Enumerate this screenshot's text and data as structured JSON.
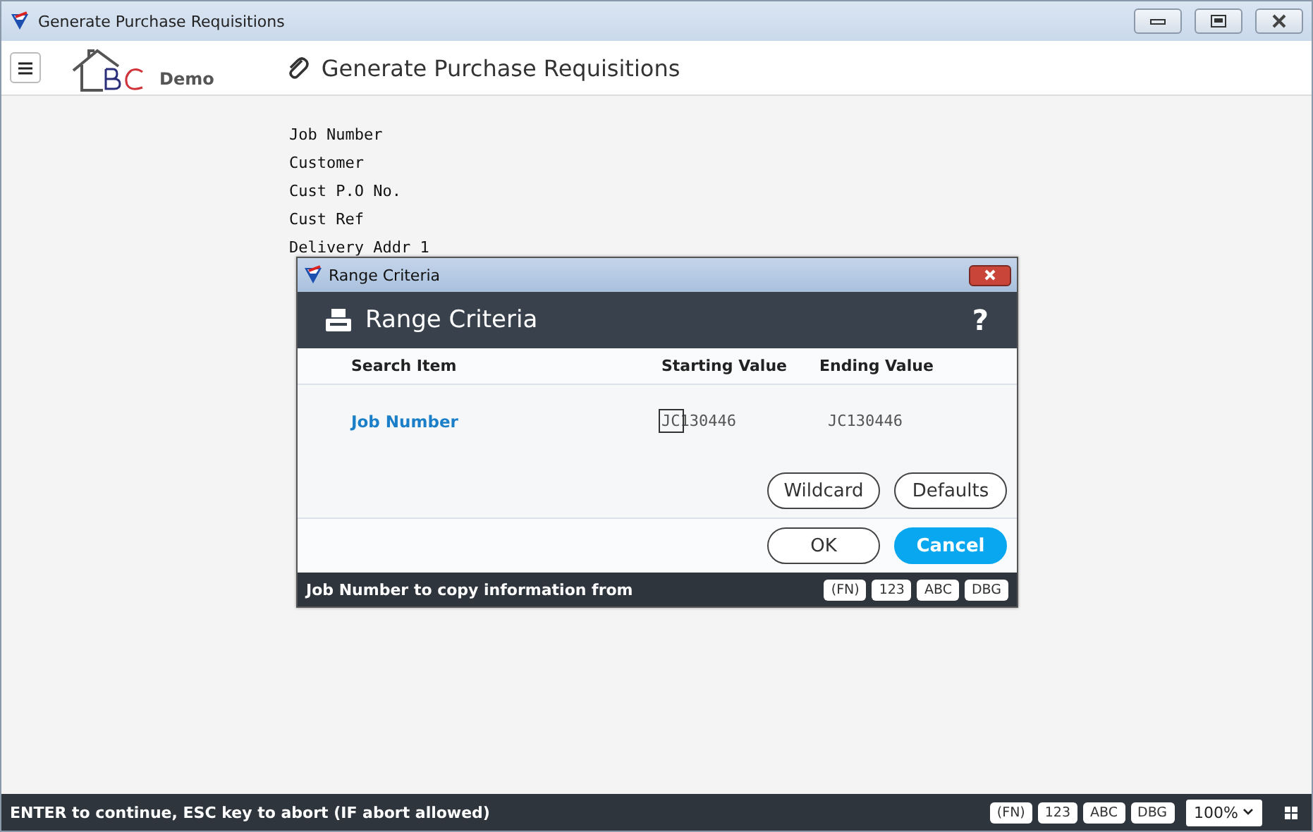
{
  "window": {
    "title": "Generate Purchase Requisitions"
  },
  "header": {
    "logo_text": "Demo",
    "title": "Generate Purchase Requisitions"
  },
  "form_labels": [
    "Job Number",
    "Customer",
    "Cust P.O No.",
    "Cust Ref",
    "Delivery Addr 1"
  ],
  "dialog": {
    "window_title": "Range Criteria",
    "heading": "Range Criteria",
    "help": "?",
    "columns": [
      "Search Item",
      "Starting Value",
      "Ending Value"
    ],
    "rows": [
      {
        "item": "Job Number",
        "start": "JC130446",
        "end": "JC130446"
      }
    ],
    "buttons": [
      {
        "label": "Wildcard",
        "primary": false
      },
      {
        "label": "Defaults",
        "primary": false
      }
    ],
    "actions": [
      {
        "label": "OK",
        "primary": false
      },
      {
        "label": "Cancel",
        "primary": true
      }
    ],
    "hint": "Job Number to copy information from",
    "modes": [
      "(FN)",
      "123",
      "ABC",
      "DBG"
    ]
  },
  "status_bar": {
    "text": "ENTER to continue, ESC key to abort (IF abort allowed)",
    "modes": [
      "(FN)",
      "123",
      "ABC",
      "DBG"
    ],
    "zoom": "100%"
  }
}
